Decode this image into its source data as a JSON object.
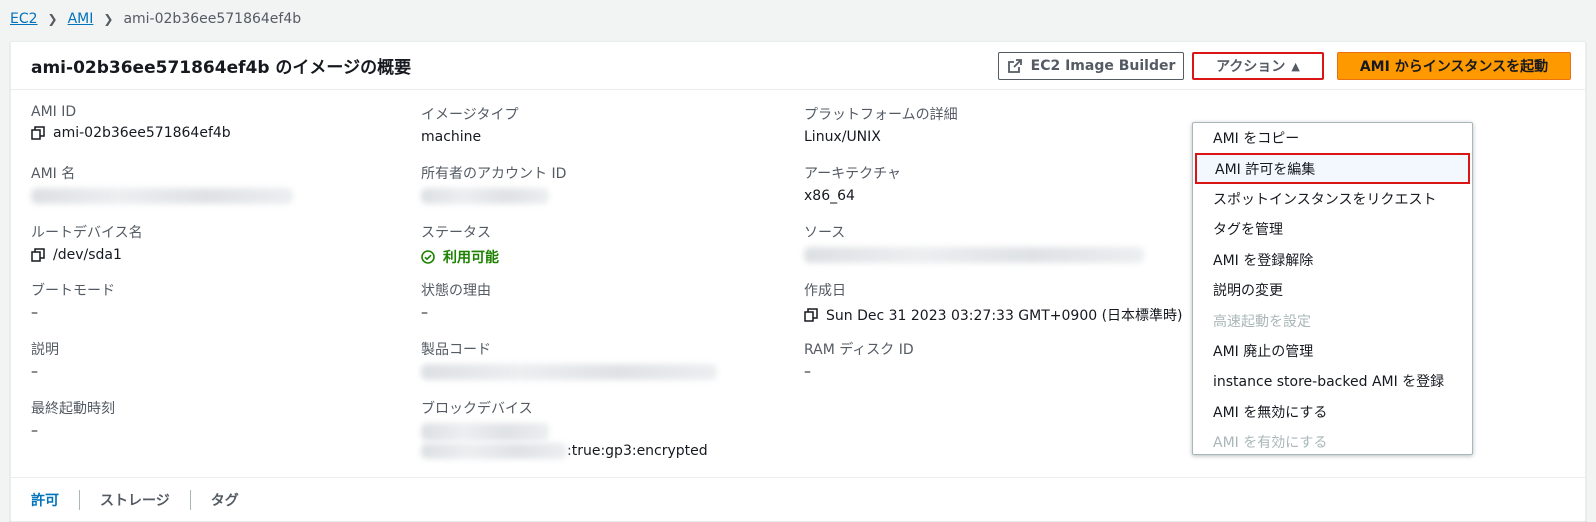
{
  "breadcrumb": {
    "items": [
      "EC2",
      "AMI"
    ],
    "current": "ami-02b36ee571864ef4b"
  },
  "header": {
    "title": "ami-02b36ee571864ef4b のイメージの概要",
    "builder_button": "EC2 Image Builder",
    "actions_button": "アクション",
    "launch_button": "AMI からインスタンスを起動"
  },
  "details": {
    "ami_id": {
      "label": "AMI ID",
      "value": "ami-02b36ee571864ef4b"
    },
    "image_type": {
      "label": "イメージタイプ",
      "value": "machine"
    },
    "platform": {
      "label": "プラットフォームの詳細",
      "value": "Linux/UNIX"
    },
    "ami_name": {
      "label": "AMI 名"
    },
    "owner_account": {
      "label": "所有者のアカウント ID"
    },
    "architecture": {
      "label": "アーキテクチャ",
      "value": "x86_64"
    },
    "root_device": {
      "label": "ルートデバイス名",
      "value": "/dev/sda1"
    },
    "status": {
      "label": "ステータス",
      "value": "利用可能"
    },
    "source": {
      "label": "ソース"
    },
    "boot_mode": {
      "label": "ブートモード",
      "value": "–"
    },
    "state_reason": {
      "label": "状態の理由",
      "value": "–"
    },
    "created": {
      "label": "作成日",
      "value": "Sun Dec 31 2023 03:27:33 GMT+0900 (日本標準時)"
    },
    "description": {
      "label": "説明",
      "value": "–"
    },
    "product_code": {
      "label": "製品コード"
    },
    "ram_disk": {
      "label": "RAM ディスク ID",
      "value": "–"
    },
    "last_launch": {
      "label": "最終起動時刻",
      "value": "–"
    },
    "block_device": {
      "label": "ブロックデバイス",
      "value_suffix": ":true:gp3:encrypted"
    }
  },
  "tabs": [
    "許可",
    "ストレージ",
    "タグ"
  ],
  "actions_menu": [
    {
      "label": "AMI をコピー",
      "disabled": false
    },
    {
      "label": "AMI 許可を編集",
      "disabled": false
    },
    {
      "label": "スポットインスタンスをリクエスト",
      "disabled": false
    },
    {
      "label": "タグを管理",
      "disabled": false
    },
    {
      "label": "AMI を登録解除",
      "disabled": false
    },
    {
      "label": "説明の変更",
      "disabled": false
    },
    {
      "label": "高速起動を設定",
      "disabled": true
    },
    {
      "label": "AMI 廃止の管理",
      "disabled": false
    },
    {
      "label": "instance store-backed AMI を登録",
      "disabled": false
    },
    {
      "label": "AMI を無効にする",
      "disabled": false
    },
    {
      "label": "AMI を有効にする",
      "disabled": true
    }
  ],
  "colors": {
    "accent": "#0073bb",
    "primary_button": "#ff9900",
    "success": "#1d8102",
    "highlight_border": "#d91515"
  }
}
